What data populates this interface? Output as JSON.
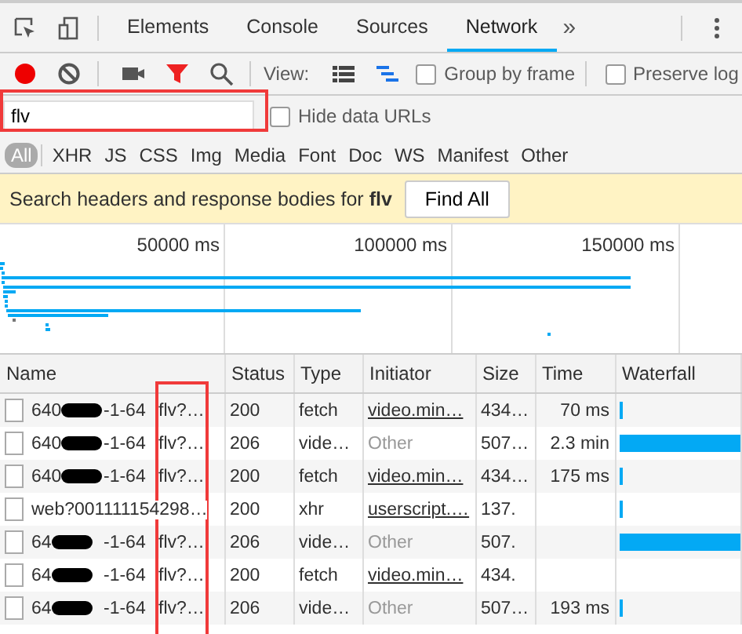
{
  "tabs": [
    {
      "label": "Elements",
      "selected": false
    },
    {
      "label": "Console",
      "selected": false
    },
    {
      "label": "Sources",
      "selected": false
    },
    {
      "label": "Network",
      "selected": true
    }
  ],
  "more_tabs": "»",
  "controls": {
    "recording": true,
    "filter_active": true,
    "view_label": "View:",
    "large_rows": false,
    "overview": true,
    "group_by_frame": {
      "label": "Group by frame",
      "checked": false
    },
    "preserve_log": {
      "label": "Preserve log",
      "checked": false
    }
  },
  "filter": {
    "value": "flv",
    "hide_data_urls": {
      "label": "Hide data URLs",
      "checked": false
    }
  },
  "type_filters": [
    {
      "label": "All",
      "selected": true
    },
    {
      "label": "XHR",
      "selected": false
    },
    {
      "label": "JS",
      "selected": false
    },
    {
      "label": "CSS",
      "selected": false
    },
    {
      "label": "Img",
      "selected": false
    },
    {
      "label": "Media",
      "selected": false
    },
    {
      "label": "Font",
      "selected": false
    },
    {
      "label": "Doc",
      "selected": false
    },
    {
      "label": "WS",
      "selected": false
    },
    {
      "label": "Manifest",
      "selected": false
    },
    {
      "label": "Other",
      "selected": false
    }
  ],
  "search_banner": {
    "text": "Search headers and response bodies for **flv**",
    "button": "Find All"
  },
  "timeline": {
    "ticks": [
      "50000 ms",
      "100000 ms",
      "150000 ms"
    ]
  },
  "table": {
    "columns": [
      "Name",
      "Status",
      "Type",
      "Initiator",
      "Size",
      "Time",
      "Waterfall"
    ],
    "rows": [
      {
        "name_prefix": "640",
        "redacted": true,
        "name_suffix": "-1-64",
        "name_ext": "flv?…",
        "status": "200",
        "type": "fetch",
        "initiator": "video.min…",
        "initiator_link": true,
        "size": "434…",
        "time": "70 ms",
        "level": 0.02
      },
      {
        "name_prefix": "640",
        "redacted": true,
        "name_suffix": "-1-64",
        "name_ext": "flv?…",
        "status": "206",
        "type": "vide…",
        "initiator": "Other",
        "initiator_link": false,
        "size": "507…",
        "time": "2.3 min",
        "level": 1
      },
      {
        "name_prefix": "640",
        "redacted": true,
        "name_suffix": "-1-64",
        "name_ext": "flv?…",
        "status": "200",
        "type": "fetch",
        "initiator": "video.min…",
        "initiator_link": true,
        "size": "434…",
        "time": "175 ms",
        "level": 0.02
      },
      {
        "name_prefix": "web?001111154298…",
        "redacted": false,
        "status": "200",
        "type": "xhr",
        "initiator": "userscript.…",
        "initiator_link": true,
        "size": "137.",
        "level": 0.02
      },
      {
        "name_prefix": "64",
        "redacted": true,
        "name_suffix": "-1-64",
        "name_ext": "flv?…",
        "status": "206",
        "type": "vide…",
        "initiator": "Other",
        "initiator_link": false,
        "size": "507.",
        "level": 1
      },
      {
        "name_prefix": "64",
        "redacted": true,
        "name_suffix": "-1-64",
        "name_ext": "flv?…",
        "status": "200",
        "type": "fetch",
        "initiator": "video.min…",
        "initiator_link": true,
        "size": "434."
      },
      {
        "name_prefix": "64",
        "redacted": true,
        "name_suffix": "-1-64",
        "name_ext": "flv?…",
        "status": "206",
        "type": "vide…",
        "initiator": "Other",
        "initiator_link": false,
        "size": "507…",
        "time": "193 ms",
        "level": 0.02
      }
    ]
  }
}
